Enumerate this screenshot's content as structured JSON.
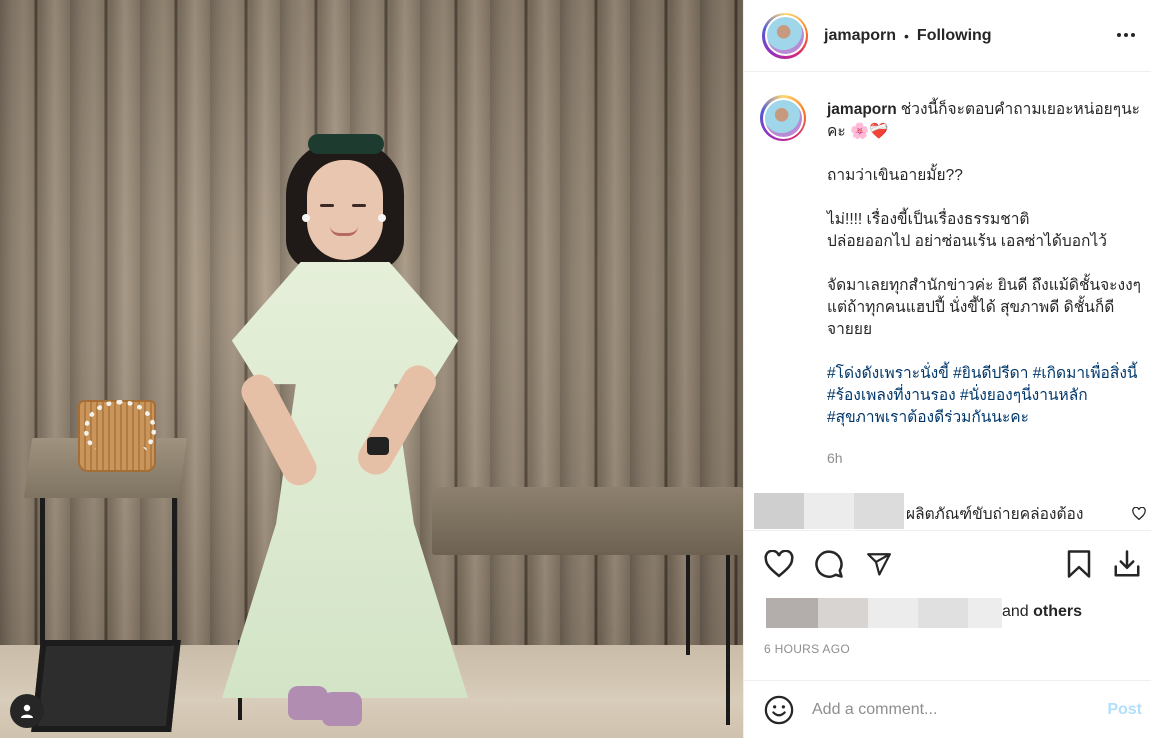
{
  "post": {
    "username": "jamaporn",
    "separator": "•",
    "follow_status": "Following",
    "more_icon": "more-horizontal-icon"
  },
  "caption": {
    "username": "jamaporn",
    "lines": [
      "ช่วงนี้ก็จะตอบคำถามเยอะหน่อยๆนะคะ 🌸❤️‍🩹",
      "ถามว่าเขินอายมั้ย??",
      "ไม่!!!! เรื่องขี้เป็นเรื่องธรรมชาติ\nปล่อยออกไป อย่าซ่อนเร้น เอลซ่าได้บอกไว้",
      "จัดมาเลยทุกสำนักข่าวค่ะ ยินดี ถึงแม้ดิชั้นจะงงๆ แต่ถ้าทุกคนแฮปปี้ นั่งขี้ได้ สุขภาพดี ดิชั้นก็ดีจายยย"
    ],
    "hashtags": "#โด่งดังเพราะนั่งขี้ #ยินดีปรีดา #เกิดมาเพื่อสิ่งนี้ #ร้องเพลงที่งานรอง #นั่งยองๆนี่งานหลัก #สุขภาพเราต้องดีร่วมกันนะคะ",
    "time_ago": "6h"
  },
  "comment": {
    "text": "ผลิตภัณฑ์ขับถ่ายคล่องต้อง",
    "like_icon": "heart-small-icon"
  },
  "actions": {
    "like_icon": "heart-icon",
    "comment_icon": "comment-icon",
    "share_icon": "send-icon",
    "save_icon": "bookmark-icon",
    "download_icon": "download-icon"
  },
  "likes": {
    "suffix": "and",
    "others": "others"
  },
  "timestamp": "6 HOURS AGO",
  "add_comment": {
    "placeholder": "Add a comment...",
    "post_label": "Post",
    "emoji_icon": "smiley-icon"
  },
  "colors": {
    "link": "#00376b",
    "muted": "#8e8e8e",
    "post_disabled": "#b2dffc",
    "text": "#262626"
  }
}
